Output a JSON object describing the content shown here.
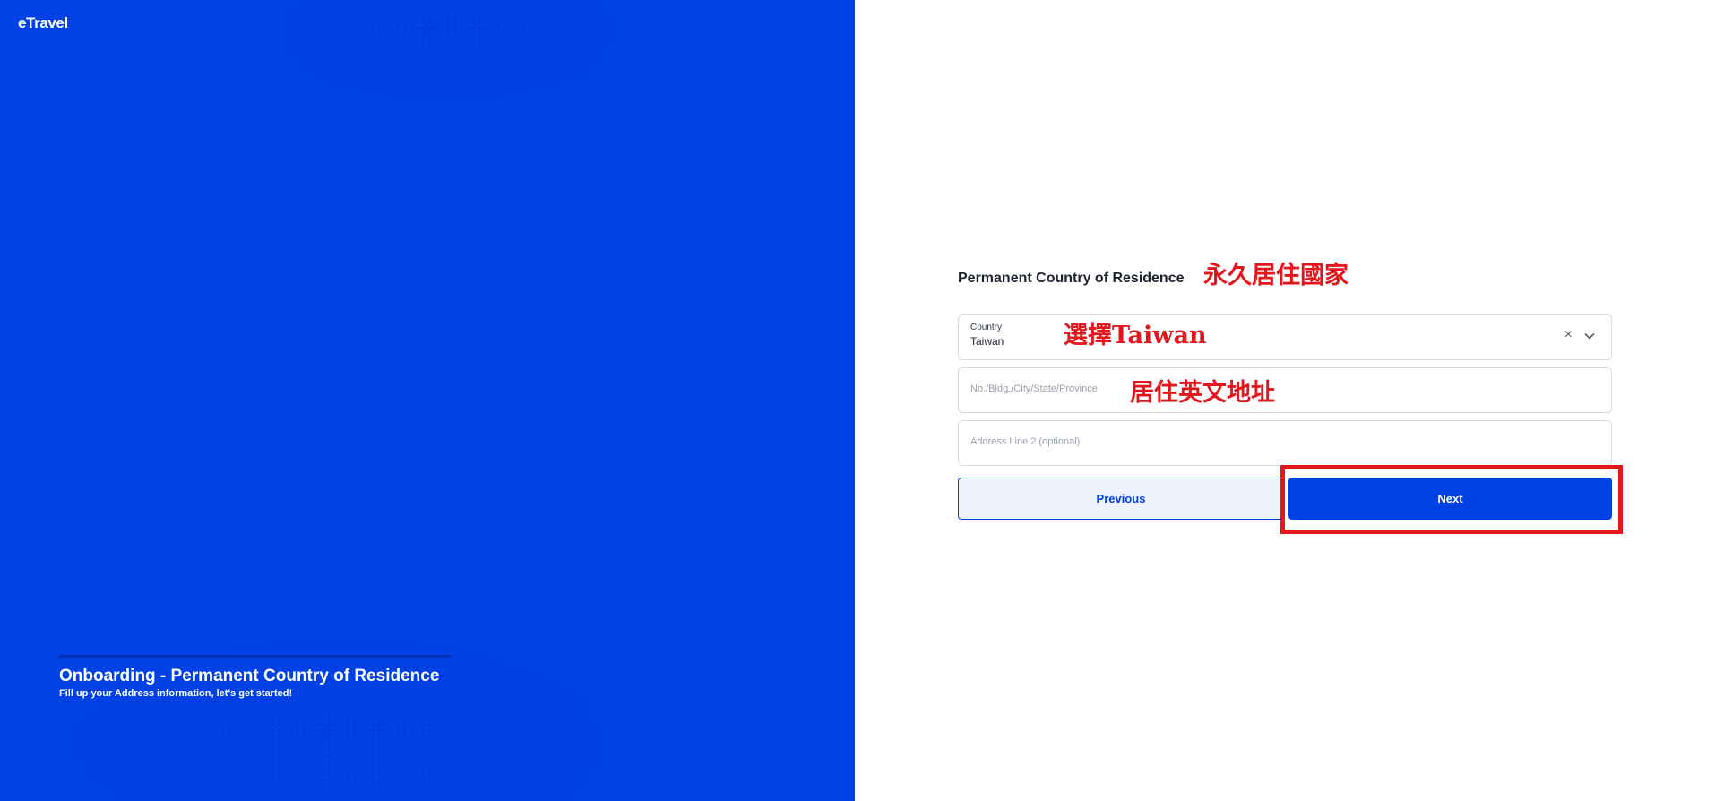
{
  "brand": {
    "logo_text": "eTravel",
    "primary_color": "#0041e6"
  },
  "left_panel": {
    "title": "Onboarding - Permanent Country of Residence",
    "subtitle": "Fill up your Address information, let's get started!"
  },
  "form": {
    "section_title": "Permanent Country of Residence",
    "country": {
      "label": "Country",
      "value": "Taiwan"
    },
    "address_line1": {
      "placeholder": "No./Bldg./City/State/Province"
    },
    "address_line2": {
      "placeholder": "Address Line 2 (optional)"
    },
    "previous_label": "Previous",
    "next_label": "Next"
  },
  "annotations": {
    "section_note": "永久居住國家",
    "country_note": "選擇Taiwan",
    "address_note": "居住英文地址",
    "color": "#e3161b"
  }
}
